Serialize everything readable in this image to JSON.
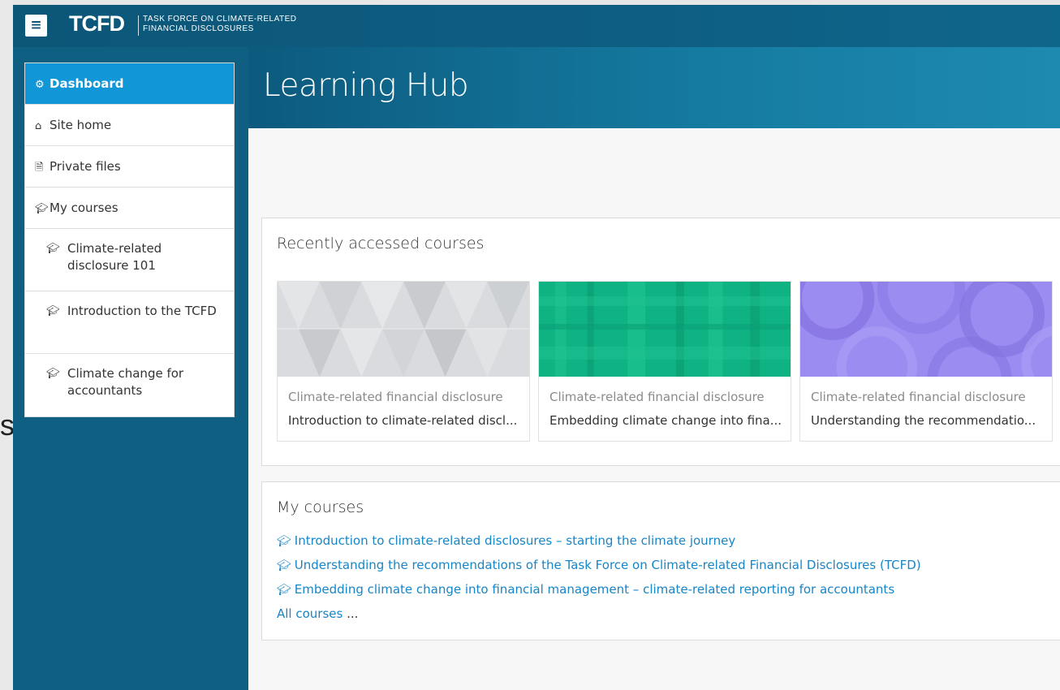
{
  "brand": {
    "logo": "TCFD",
    "subtitle_line1": "TASK FORCE ON CLIMATE-RELATED",
    "subtitle_line2": "FINANCIAL DISCLOSURES"
  },
  "menu_button_glyph": "≡",
  "page_title": "Learning Hub",
  "background_fragment": "s",
  "nav": {
    "items": [
      {
        "label": "Dashboard",
        "icon": "dashboard-icon",
        "active": true
      },
      {
        "label": "Site home",
        "icon": "home-icon"
      },
      {
        "label": "Private files",
        "icon": "file-icon"
      },
      {
        "label": "My courses",
        "icon": "graduation-cap-icon"
      },
      {
        "label": "Climate-related disclosure 101",
        "icon": "graduation-cap-icon"
      },
      {
        "label": "Introduction to the TCFD",
        "icon": "graduation-cap-icon"
      },
      {
        "label": "Climate change for accountants",
        "icon": "graduation-cap-icon"
      }
    ]
  },
  "recent": {
    "title": "Recently accessed courses",
    "courses": [
      {
        "category": "Climate-related financial disclosure",
        "name": "Introduction to climate-related discl...",
        "image_color": "#d7d9dc"
      },
      {
        "category": "Climate-related financial disclosure",
        "name": "Embedding climate change into fina...",
        "image_color": "#0fb383"
      },
      {
        "category": "Climate-related financial disclosure",
        "name": "Understanding the recommendatio...",
        "image_color": "#9b8cf2"
      }
    ]
  },
  "my_courses": {
    "title": "My courses",
    "links": [
      "Introduction to climate-related disclosures – starting the climate journey",
      "Understanding the recommendations of the Task Force on Climate-related Financial Disclosures (TCFD)",
      "Embedding climate change into financial management – climate-related reporting for accountants"
    ],
    "all_courses_label": "All courses",
    "all_courses_suffix": "..."
  },
  "colors": {
    "header": "#0c5678",
    "nav_active": "#1196d8",
    "link": "#1785c6"
  }
}
